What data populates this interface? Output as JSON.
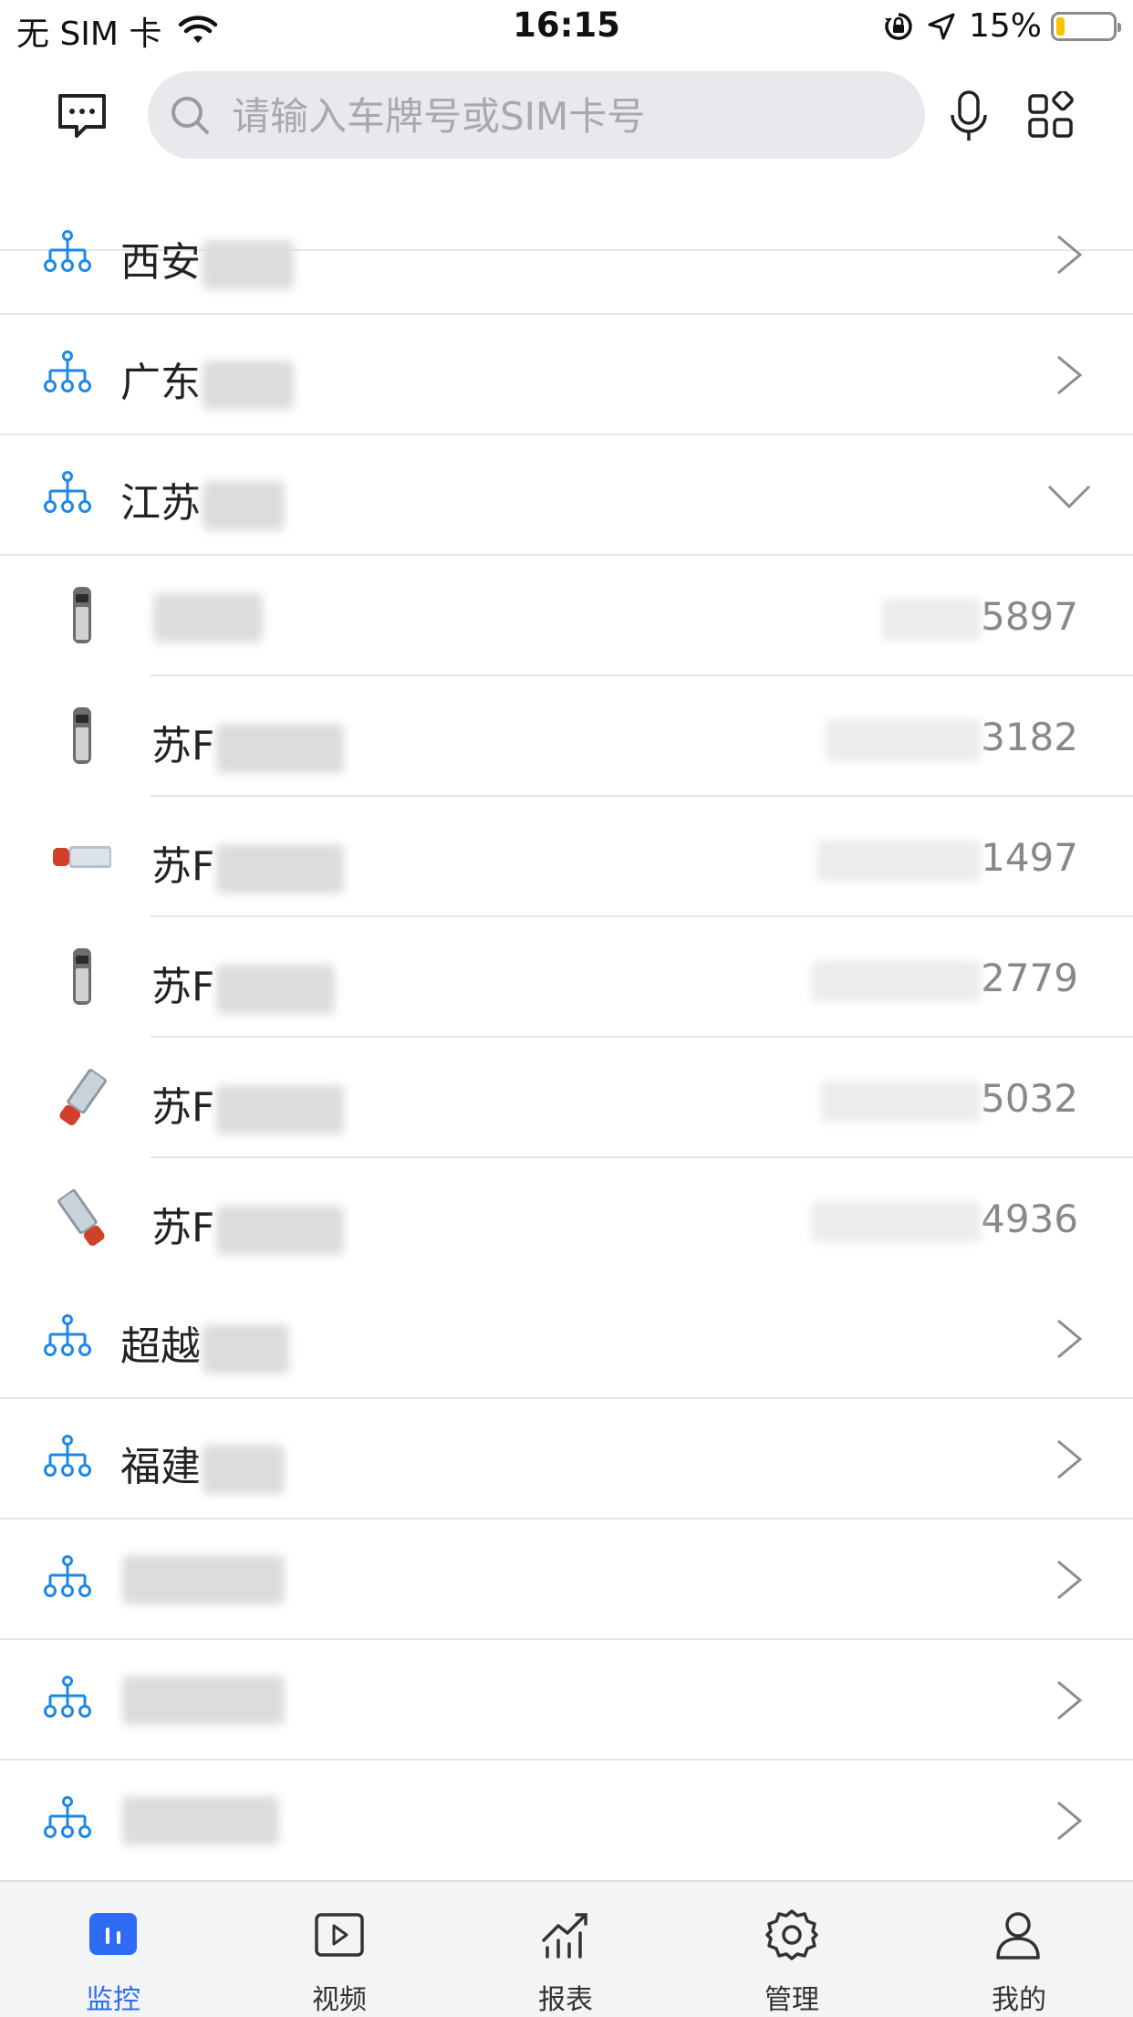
{
  "status_bar": {
    "carrier": "无 SIM 卡",
    "time": "16:15",
    "battery": "15%",
    "battery_level": 0.15,
    "icons": [
      "wifi-icon",
      "rotation-lock-icon",
      "location-arrow-icon",
      "battery-icon"
    ]
  },
  "header": {
    "search_placeholder": "请输入车牌号或SIM卡号",
    "icons": [
      "message-icon",
      "search-icon",
      "microphone-icon",
      "grid-apps-icon"
    ]
  },
  "tree": {
    "groups_top": [
      {
        "name": "西安",
        "expanded": false
      },
      {
        "name": "广东",
        "expanded": false
      },
      {
        "name": "江苏",
        "expanded": true
      }
    ],
    "vehicles": [
      {
        "plate": "",
        "sim_suffix": "5897",
        "icon": "van-gray-icon"
      },
      {
        "plate": "苏F",
        "sim_suffix": "3182",
        "icon": "van-gray-icon"
      },
      {
        "plate": "苏F",
        "sim_suffix": "1497",
        "icon": "truck-red-icon"
      },
      {
        "plate": "苏F",
        "sim_suffix": "2779",
        "icon": "van-gray-icon"
      },
      {
        "plate": "苏F",
        "sim_suffix": "5032",
        "icon": "truck-red-icon"
      },
      {
        "plate": "苏F",
        "sim_suffix": "4936",
        "icon": "truck-red-icon"
      }
    ],
    "groups_bottom": [
      {
        "name": "超越"
      },
      {
        "name": "福建"
      },
      {
        "name": ""
      },
      {
        "name": ""
      },
      {
        "name": ""
      }
    ]
  },
  "tabbar": {
    "tabs": [
      {
        "label": "监控",
        "active": true,
        "icon": "monitor-icon"
      },
      {
        "label": "视频",
        "active": false,
        "icon": "video-icon"
      },
      {
        "label": "报表",
        "active": false,
        "icon": "report-chart-icon"
      },
      {
        "label": "管理",
        "active": false,
        "icon": "settings-gear-icon"
      },
      {
        "label": "我的",
        "active": false,
        "icon": "user-icon"
      }
    ]
  },
  "colors": {
    "accent": "#2f6cf6",
    "org_icon": "#1e88e5",
    "divider": "#e6e6e6",
    "search_bg": "#e8e9ec",
    "battery_fill": "#f5c400"
  }
}
